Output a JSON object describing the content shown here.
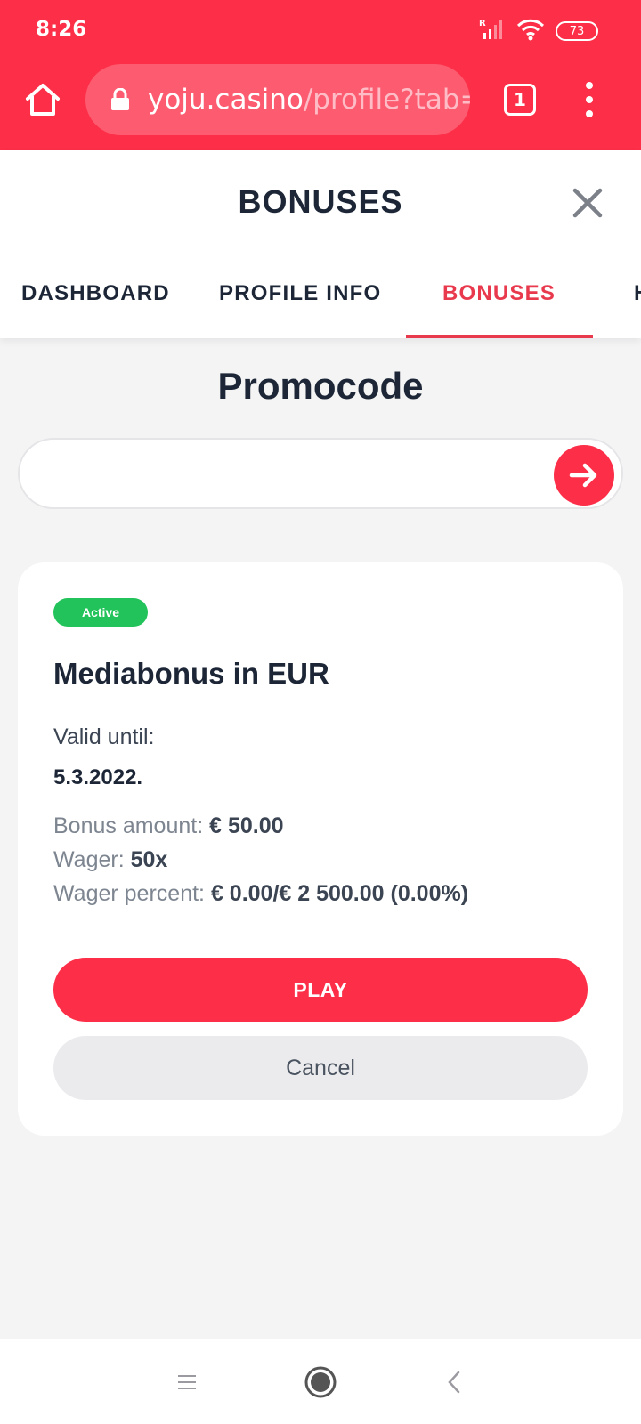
{
  "status_bar": {
    "time": "8:26",
    "battery": "73"
  },
  "browser": {
    "url_domain": "yoju.casino",
    "url_path": "/profile?tab=",
    "tab_count": "1"
  },
  "header": {
    "title": "BONUSES",
    "tabs": [
      {
        "label": "DASHBOARD"
      },
      {
        "label": "PROFILE INFO"
      },
      {
        "label": "BONUSES"
      },
      {
        "label": "H"
      }
    ]
  },
  "promocode": {
    "title": "Promocode",
    "value": "",
    "placeholder": ""
  },
  "bonus_card": {
    "status": "Active",
    "name": "Mediabonus in EUR",
    "valid_label": "Valid until:",
    "valid_date": "5.3.2022.",
    "amount_label": "Bonus amount:",
    "amount_value": "€ 50.00",
    "wager_label": "Wager:",
    "wager_value": "50x",
    "wager_percent_label": "Wager percent:",
    "wager_percent_value": "€ 0.00/€ 2 500.00 (0.00%)",
    "play_label": "PLAY",
    "cancel_label": "Cancel"
  },
  "colors": {
    "brand": "#fc2e48",
    "active_tab": "#e8394d",
    "badge_active": "#22c35a"
  }
}
